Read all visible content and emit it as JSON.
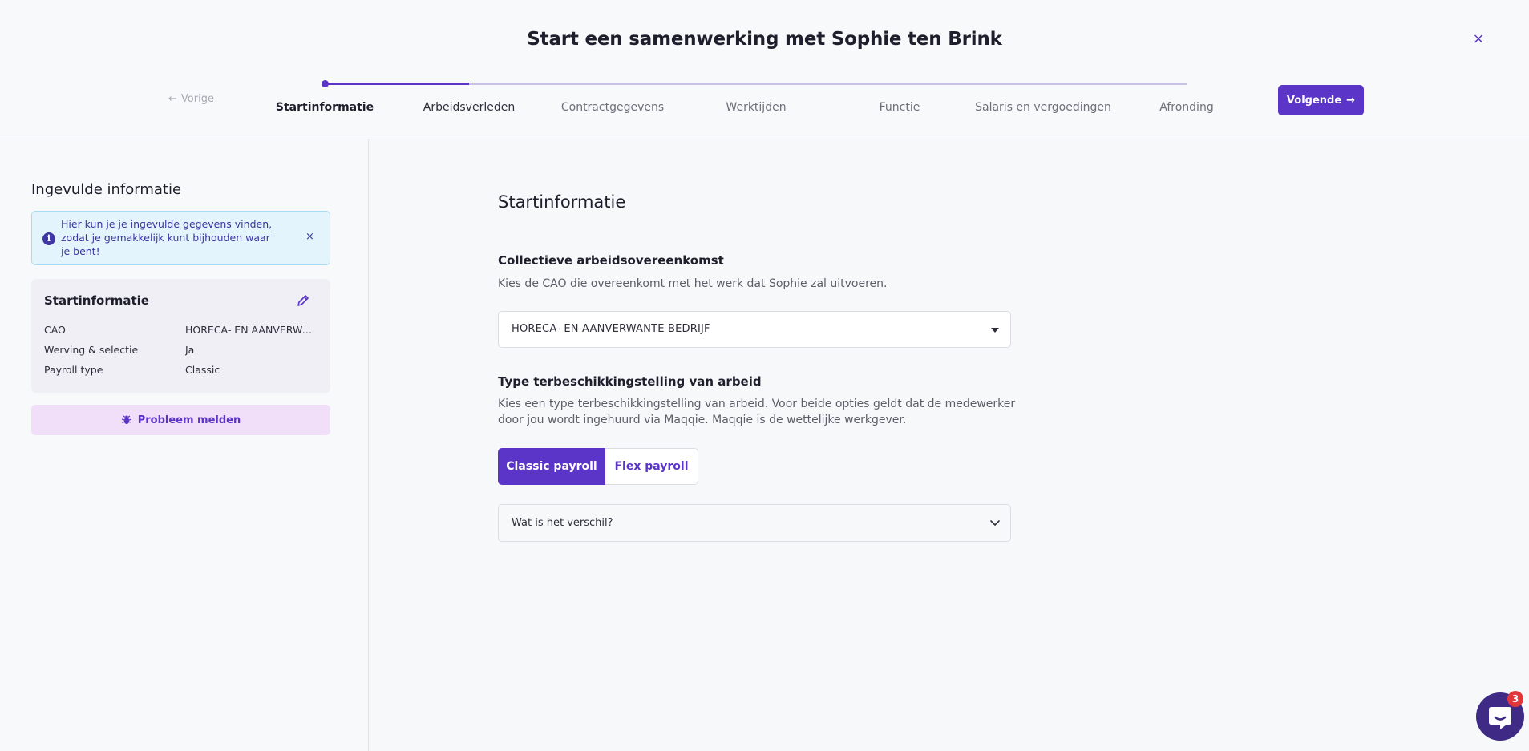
{
  "header": {
    "title": "Start een samenwerking met Sophie ten Brink",
    "close_label": "×",
    "prev_label": "Vorige",
    "next_label": "Volgende",
    "progress_fraction": 0.167,
    "steps": [
      {
        "label": "Startinformatie",
        "state": "active"
      },
      {
        "label": "Arbeidsverleden",
        "state": "done"
      },
      {
        "label": "Contractgegevens",
        "state": "future"
      },
      {
        "label": "Werktijden",
        "state": "future"
      },
      {
        "label": "Functie",
        "state": "future"
      },
      {
        "label": "Salaris en vergoedingen",
        "state": "future"
      },
      {
        "label": "Afronding",
        "state": "future"
      }
    ]
  },
  "sidebar": {
    "title": "Ingevulde informatie",
    "info_text": "Hier kun je je ingevulde gegevens vinden, zodat je gemakkelijk kunt bijhouden waar je bent!",
    "info_close": "×",
    "summary": {
      "title": "Startinformatie",
      "rows": [
        {
          "label": "CAO",
          "value": "HORECA- EN AANVERWANTE BEDRIJF"
        },
        {
          "label": "Werving & selectie",
          "value": "Ja"
        },
        {
          "label": "Payroll type",
          "value": "Classic"
        }
      ]
    },
    "report_label": "Probleem melden"
  },
  "main": {
    "title": "Startinformatie",
    "cao": {
      "title": "Collectieve arbeidsovereenkomst",
      "description": "Kies de CAO die overeenkomt met het werk dat Sophie zal uitvoeren.",
      "selected": "HORECA- EN AANVERWANTE BEDRIJF"
    },
    "type": {
      "title": "Type terbeschikkingstelling van arbeid",
      "description": "Kies een type terbeschikkingstelling van arbeid. Voor beide opties geldt dat de medewerker door jou wordt ingehuurd via Maqqie. Maqqie is de wettelijke werkgever.",
      "options": [
        "Classic payroll",
        "Flex payroll"
      ],
      "selected": "Classic payroll"
    },
    "accordion_label": "Wat is het verschil?"
  },
  "help": {
    "badge_count": "3"
  },
  "colors": {
    "accent": "#5b34c8",
    "info_bg": "#e3f4fc",
    "report_bg": "#f1def9",
    "badge": "#e2363b"
  }
}
